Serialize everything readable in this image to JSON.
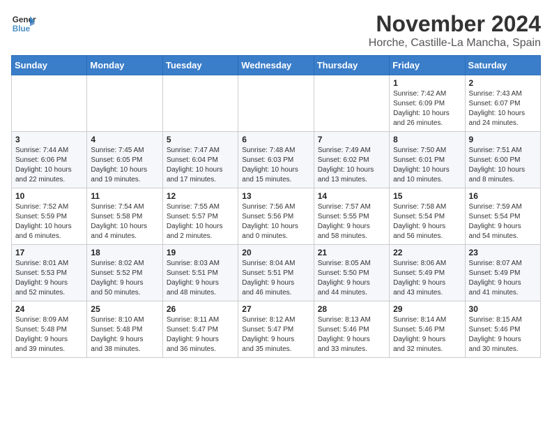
{
  "header": {
    "logo_line1": "General",
    "logo_line2": "Blue",
    "month": "November 2024",
    "location": "Horche, Castille-La Mancha, Spain"
  },
  "weekdays": [
    "Sunday",
    "Monday",
    "Tuesday",
    "Wednesday",
    "Thursday",
    "Friday",
    "Saturday"
  ],
  "weeks": [
    [
      {
        "day": "",
        "info": ""
      },
      {
        "day": "",
        "info": ""
      },
      {
        "day": "",
        "info": ""
      },
      {
        "day": "",
        "info": ""
      },
      {
        "day": "",
        "info": ""
      },
      {
        "day": "1",
        "info": "Sunrise: 7:42 AM\nSunset: 6:09 PM\nDaylight: 10 hours\nand 26 minutes."
      },
      {
        "day": "2",
        "info": "Sunrise: 7:43 AM\nSunset: 6:07 PM\nDaylight: 10 hours\nand 24 minutes."
      }
    ],
    [
      {
        "day": "3",
        "info": "Sunrise: 7:44 AM\nSunset: 6:06 PM\nDaylight: 10 hours\nand 22 minutes."
      },
      {
        "day": "4",
        "info": "Sunrise: 7:45 AM\nSunset: 6:05 PM\nDaylight: 10 hours\nand 19 minutes."
      },
      {
        "day": "5",
        "info": "Sunrise: 7:47 AM\nSunset: 6:04 PM\nDaylight: 10 hours\nand 17 minutes."
      },
      {
        "day": "6",
        "info": "Sunrise: 7:48 AM\nSunset: 6:03 PM\nDaylight: 10 hours\nand 15 minutes."
      },
      {
        "day": "7",
        "info": "Sunrise: 7:49 AM\nSunset: 6:02 PM\nDaylight: 10 hours\nand 13 minutes."
      },
      {
        "day": "8",
        "info": "Sunrise: 7:50 AM\nSunset: 6:01 PM\nDaylight: 10 hours\nand 10 minutes."
      },
      {
        "day": "9",
        "info": "Sunrise: 7:51 AM\nSunset: 6:00 PM\nDaylight: 10 hours\nand 8 minutes."
      }
    ],
    [
      {
        "day": "10",
        "info": "Sunrise: 7:52 AM\nSunset: 5:59 PM\nDaylight: 10 hours\nand 6 minutes."
      },
      {
        "day": "11",
        "info": "Sunrise: 7:54 AM\nSunset: 5:58 PM\nDaylight: 10 hours\nand 4 minutes."
      },
      {
        "day": "12",
        "info": "Sunrise: 7:55 AM\nSunset: 5:57 PM\nDaylight: 10 hours\nand 2 minutes."
      },
      {
        "day": "13",
        "info": "Sunrise: 7:56 AM\nSunset: 5:56 PM\nDaylight: 10 hours\nand 0 minutes."
      },
      {
        "day": "14",
        "info": "Sunrise: 7:57 AM\nSunset: 5:55 PM\nDaylight: 9 hours\nand 58 minutes."
      },
      {
        "day": "15",
        "info": "Sunrise: 7:58 AM\nSunset: 5:54 PM\nDaylight: 9 hours\nand 56 minutes."
      },
      {
        "day": "16",
        "info": "Sunrise: 7:59 AM\nSunset: 5:54 PM\nDaylight: 9 hours\nand 54 minutes."
      }
    ],
    [
      {
        "day": "17",
        "info": "Sunrise: 8:01 AM\nSunset: 5:53 PM\nDaylight: 9 hours\nand 52 minutes."
      },
      {
        "day": "18",
        "info": "Sunrise: 8:02 AM\nSunset: 5:52 PM\nDaylight: 9 hours\nand 50 minutes."
      },
      {
        "day": "19",
        "info": "Sunrise: 8:03 AM\nSunset: 5:51 PM\nDaylight: 9 hours\nand 48 minutes."
      },
      {
        "day": "20",
        "info": "Sunrise: 8:04 AM\nSunset: 5:51 PM\nDaylight: 9 hours\nand 46 minutes."
      },
      {
        "day": "21",
        "info": "Sunrise: 8:05 AM\nSunset: 5:50 PM\nDaylight: 9 hours\nand 44 minutes."
      },
      {
        "day": "22",
        "info": "Sunrise: 8:06 AM\nSunset: 5:49 PM\nDaylight: 9 hours\nand 43 minutes."
      },
      {
        "day": "23",
        "info": "Sunrise: 8:07 AM\nSunset: 5:49 PM\nDaylight: 9 hours\nand 41 minutes."
      }
    ],
    [
      {
        "day": "24",
        "info": "Sunrise: 8:09 AM\nSunset: 5:48 PM\nDaylight: 9 hours\nand 39 minutes."
      },
      {
        "day": "25",
        "info": "Sunrise: 8:10 AM\nSunset: 5:48 PM\nDaylight: 9 hours\nand 38 minutes."
      },
      {
        "day": "26",
        "info": "Sunrise: 8:11 AM\nSunset: 5:47 PM\nDaylight: 9 hours\nand 36 minutes."
      },
      {
        "day": "27",
        "info": "Sunrise: 8:12 AM\nSunset: 5:47 PM\nDaylight: 9 hours\nand 35 minutes."
      },
      {
        "day": "28",
        "info": "Sunrise: 8:13 AM\nSunset: 5:46 PM\nDaylight: 9 hours\nand 33 minutes."
      },
      {
        "day": "29",
        "info": "Sunrise: 8:14 AM\nSunset: 5:46 PM\nDaylight: 9 hours\nand 32 minutes."
      },
      {
        "day": "30",
        "info": "Sunrise: 8:15 AM\nSunset: 5:46 PM\nDaylight: 9 hours\nand 30 minutes."
      }
    ]
  ]
}
